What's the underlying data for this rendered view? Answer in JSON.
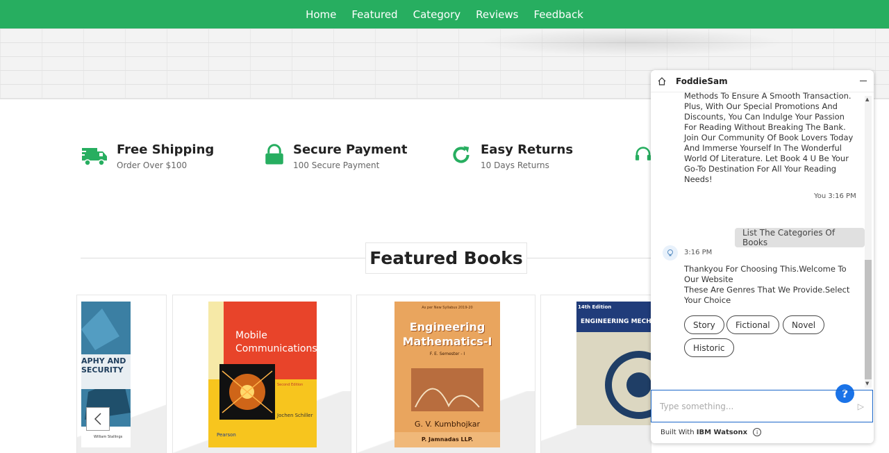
{
  "nav": {
    "items": [
      "Home",
      "Featured",
      "Category",
      "Reviews",
      "Feedback"
    ]
  },
  "features": [
    {
      "title": "Free Shipping",
      "subtitle": "Order Over $100",
      "icon": "truck-icon"
    },
    {
      "title": "Secure Payment",
      "subtitle": "100 Secure Payment",
      "icon": "lock-icon"
    },
    {
      "title": "Easy Returns",
      "subtitle": "10 Days Returns",
      "icon": "refresh-icon"
    },
    {
      "title": "",
      "subtitle": "",
      "icon": "headset-icon"
    }
  ],
  "featured": {
    "heading": "Featured Books"
  },
  "books": [
    {
      "title_lines": [
        "APHY AND",
        "SECURITY"
      ],
      "author": "William Stallings"
    },
    {
      "title_lines": [
        "Mobile",
        "Communications"
      ],
      "edition": "Second Edition",
      "author": "Jochen Schiller",
      "publisher": "Pearson"
    },
    {
      "title_lines": [
        "Engineering",
        "Mathematics-I"
      ],
      "subtitle": "F. E. Semester - I",
      "top": "As per New Syllabus 2019-20",
      "author": "G. V. Kumbhojkar",
      "publisher": "P. Jamnadas LLP."
    },
    {
      "title_lines": [
        "ENGINEERING MECH"
      ],
      "edition": "14th Edition"
    }
  ],
  "chat": {
    "title": "FoddieSam",
    "intro_text": "Methods To Ensure A Smooth Transaction. Plus, With Our Special Promotions And Discounts, You Can Indulge Your Passion For Reading Without Breaking The Bank.\nJoin Our Community Of Book Lovers Today And Immerse Yourself In The Wonderful World Of Literature. Let Book 4 U Be Your Go-To Destination For All Your Reading Needs!",
    "user_meta": "You 3:16 PM",
    "user_message": "List The Categories Of Books",
    "bot_time": "3:16 PM",
    "bot_message": "Thankyou For Choosing This.Welcome To Our Website\nThese Are Genres That We Provide.Select Your Choice",
    "options": [
      "Story",
      "Fictional",
      "Novel",
      "Historic"
    ],
    "input_placeholder": "Type something...",
    "footer_prefix": "Built With",
    "footer_brand": "IBM Watsonx"
  },
  "colors": {
    "brand": "#27ae60",
    "chat_accent": "#1a73e8"
  }
}
